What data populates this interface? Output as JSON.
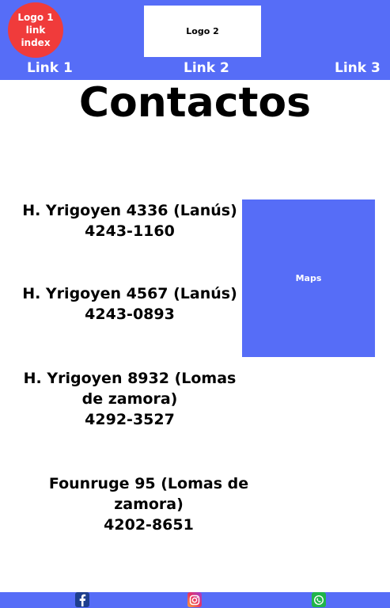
{
  "header": {
    "logo1_label": "Logo 1 link index",
    "logo2_label": "Logo 2",
    "links": [
      "Link 1",
      "Link 2",
      "Link 3"
    ]
  },
  "page_title": "Contactos",
  "contacts": [
    {
      "address": "H. Yrigoyen 4336 (Lanús)",
      "phone": "4243-1160"
    },
    {
      "address": "H. Yrigoyen 4567 (Lanús)",
      "phone": "4243-0893"
    },
    {
      "address": "H. Yrigoyen 8932 (Lomas de zamora)",
      "phone": "4292-3527"
    },
    {
      "address": "Founruge 95 (Lomas de zamora)",
      "phone": "4202-8651"
    }
  ],
  "maps_label": "Maps",
  "footer": {
    "social_icons": [
      "facebook-icon",
      "instagram-icon",
      "whatsapp-icon"
    ]
  },
  "colors": {
    "brand_blue": "#566df7",
    "logo_red": "#f03b3b"
  }
}
